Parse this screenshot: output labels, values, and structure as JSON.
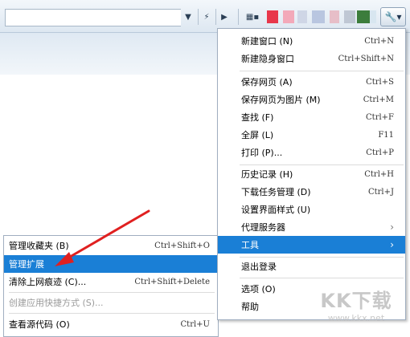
{
  "main_menu": {
    "items": [
      {
        "label": "新建窗口 (N)",
        "shortcut": "Ctrl+N"
      },
      {
        "label": "新建隐身窗口",
        "shortcut": "Ctrl+Shift+N"
      },
      {
        "label": "保存网页 (A)",
        "shortcut": "Ctrl+S"
      },
      {
        "label": "保存网页为图片 (M)",
        "shortcut": "Ctrl+M"
      },
      {
        "label": "查找 (F)",
        "shortcut": "Ctrl+F"
      },
      {
        "label": "全屏 (L)",
        "shortcut": "F11"
      },
      {
        "label": "打印 (P)...",
        "shortcut": "Ctrl+P"
      },
      {
        "label": "历史记录 (H)",
        "shortcut": "Ctrl+H"
      },
      {
        "label": "下载任务管理 (D)",
        "shortcut": "Ctrl+J"
      },
      {
        "label": "设置界面样式 (U)",
        "shortcut": ""
      },
      {
        "label": "代理服务器",
        "shortcut": ""
      },
      {
        "label": "工具",
        "shortcut": ""
      },
      {
        "label": "退出登录",
        "shortcut": ""
      },
      {
        "label": "选项 (O)",
        "shortcut": ""
      },
      {
        "label": "帮助",
        "shortcut": ""
      }
    ],
    "highlighted_item": "工具"
  },
  "tools_submenu": {
    "items": [
      {
        "label": "管理收藏夹 (B)",
        "shortcut": "Ctrl+Shift+O"
      },
      {
        "label": "管理扩展",
        "shortcut": ""
      },
      {
        "label": "清除上网痕迹 (C)...",
        "shortcut": "Ctrl+Shift+Delete"
      },
      {
        "label": "创建应用快捷方式 (S)...",
        "shortcut": ""
      },
      {
        "label": "查看源代码 (O)",
        "shortcut": "Ctrl+U"
      }
    ],
    "highlighted_item": "管理扩展",
    "disabled_item": "创建应用快捷方式 (S)..."
  },
  "watermark": {
    "brand": "KK下载",
    "url": "www.kkx.net"
  },
  "colors": {
    "highlight": "#1a7fd6",
    "annotation_arrow": "#e02020"
  }
}
